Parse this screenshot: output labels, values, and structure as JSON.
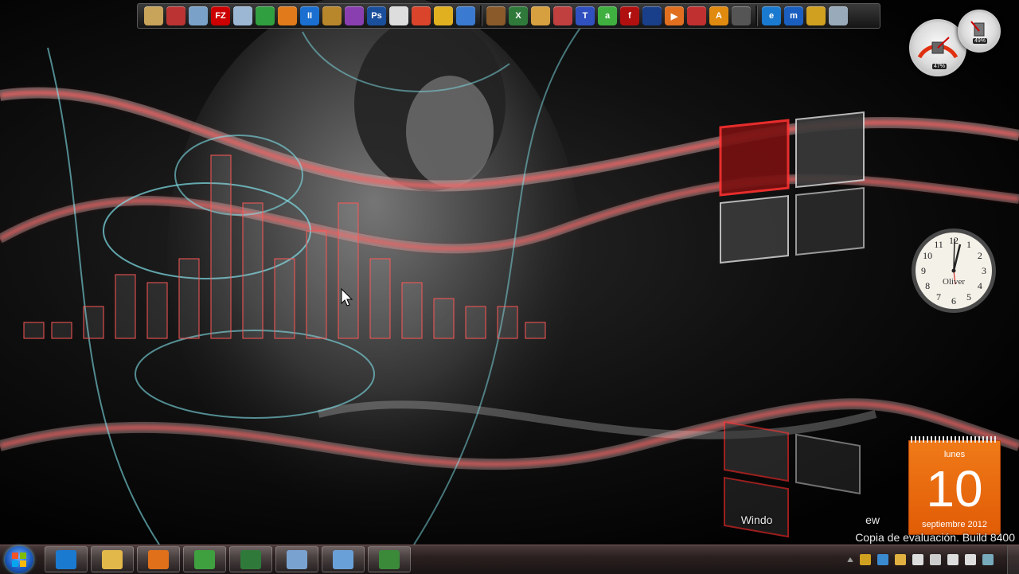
{
  "dock": {
    "icons": [
      {
        "name": "folder-tools-icon",
        "color": "#c8a35a",
        "glyph": ""
      },
      {
        "name": "screenshot-tool-icon",
        "color": "#b33",
        "glyph": ""
      },
      {
        "name": "recycle-app-icon",
        "color": "#7aa2c8",
        "glyph": ""
      },
      {
        "name": "filezilla-icon",
        "color": "#c00",
        "glyph": "FZ"
      },
      {
        "name": "document-viewer-icon",
        "color": "#9bb7d4",
        "glyph": ""
      },
      {
        "name": "messenger-people-icon",
        "color": "#2f9f3f",
        "glyph": ""
      },
      {
        "name": "media-burner-icon",
        "color": "#e07a1a",
        "glyph": ""
      },
      {
        "name": "media-pause-icon",
        "color": "#1a6fd0",
        "glyph": "II"
      },
      {
        "name": "globe-disc-icon",
        "color": "#b8862b",
        "glyph": ""
      },
      {
        "name": "winrar-icon",
        "color": "#8a3fb0",
        "glyph": ""
      },
      {
        "name": "photoshop-icon",
        "color": "#1a4f9c",
        "glyph": "Ps"
      },
      {
        "name": "mask-app-icon",
        "color": "#ddd",
        "glyph": ""
      },
      {
        "name": "chrome-browser-icon",
        "color": "#d9442b",
        "glyph": ""
      },
      {
        "name": "keys-app-icon",
        "color": "#e0b020",
        "glyph": ""
      },
      {
        "name": "network-computer-icon",
        "color": "#3a7ad0",
        "glyph": ""
      }
    ],
    "icons_group2": [
      {
        "name": "photo-app-icon",
        "color": "#8a5a2a",
        "glyph": ""
      },
      {
        "name": "excel-icon",
        "color": "#2f7a3a",
        "glyph": "X"
      },
      {
        "name": "paint-palette-icon",
        "color": "#d6a040",
        "glyph": ""
      },
      {
        "name": "tools-app-icon",
        "color": "#c04040",
        "glyph": ""
      },
      {
        "name": "text-editor-icon",
        "color": "#3050c0",
        "glyph": "T"
      },
      {
        "name": "green-circle-app-icon",
        "color": "#3fb040",
        "glyph": "a"
      },
      {
        "name": "flash-player-icon",
        "color": "#b01010",
        "glyph": "f"
      },
      {
        "name": "windows-media-icon",
        "color": "#1a3f8a",
        "glyph": ""
      },
      {
        "name": "play-orange-icon",
        "color": "#e07020",
        "glyph": "▶"
      },
      {
        "name": "pdf-app-icon",
        "color": "#c03030",
        "glyph": ""
      },
      {
        "name": "avast-icon",
        "color": "#e08a10",
        "glyph": "A"
      },
      {
        "name": "film-strip-icon",
        "color": "#555",
        "glyph": ""
      }
    ],
    "icons_group3": [
      {
        "name": "internet-explorer-icon",
        "color": "#1a7ad0",
        "glyph": "e"
      },
      {
        "name": "maxthon-icon",
        "color": "#1a5fc0",
        "glyph": "m"
      },
      {
        "name": "settings-tools-icon",
        "color": "#d0a020",
        "glyph": ""
      },
      {
        "name": "recycle-bin-icon",
        "color": "#9ab",
        "glyph": ""
      }
    ]
  },
  "gauges": {
    "cpu_value": "47%",
    "memory_value": "49%"
  },
  "clock": {
    "name": "Oliver",
    "numerals": [
      "12",
      "1",
      "2",
      "3",
      "4",
      "5",
      "6",
      "7",
      "8",
      "9",
      "10",
      "11"
    ]
  },
  "calendar": {
    "weekday": "lunes",
    "day": "10",
    "month_year": "septiembre 2012"
  },
  "watermark": {
    "line1": "Windo                              ew",
    "line2": "Copia de evaluación. Build 8400"
  },
  "taskbar": {
    "buttons": [
      {
        "name": "taskbar-internet-explorer",
        "color": "#1a7ad0"
      },
      {
        "name": "taskbar-file-explorer",
        "color": "#e3b84a"
      },
      {
        "name": "taskbar-media-player",
        "color": "#e0701a"
      },
      {
        "name": "taskbar-messenger",
        "color": "#3fa03f"
      },
      {
        "name": "taskbar-excel",
        "color": "#2f7a3a"
      },
      {
        "name": "taskbar-document",
        "color": "#7aa2d0"
      },
      {
        "name": "taskbar-control-panel",
        "color": "#6aa0d8"
      },
      {
        "name": "taskbar-app-green",
        "color": "#3a8a3a"
      }
    ]
  },
  "tray": {
    "icons": [
      "chevron-up-icon",
      "messenger-tray-icon",
      "network-globe-icon",
      "update-tray-icon",
      "flag-tray-icon",
      "usb-tray-icon",
      "signal-bars-icon",
      "volume-icon",
      "notes-tray-icon"
    ]
  },
  "colors": {
    "accent_red": "#ff2a2a",
    "accent_cyan": "#7fe0e8",
    "calendar_orange": "#ee6f12"
  }
}
